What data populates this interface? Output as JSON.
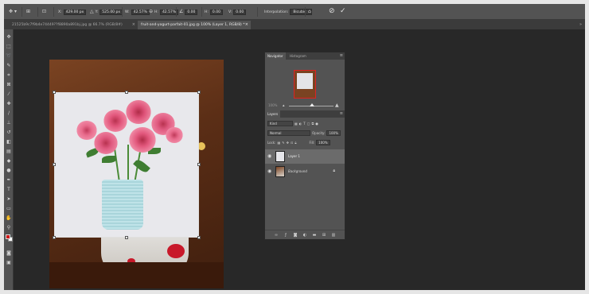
{
  "options_bar": {
    "x_label": "X:",
    "x_value": "429.00 px",
    "y_label": "Y:",
    "y_value": "525.00 px",
    "w_label": "W:",
    "w_value": "42.57%",
    "h_label": "H:",
    "h_value": "42.57%",
    "angle_value": "0.00",
    "hskew_label": "H:",
    "hskew_value": "0.00",
    "vskew_label": "V:",
    "vskew_value": "0.00",
    "interpolation_label": "Interpolation:",
    "interpolation_value": "Bicubic",
    "cancel_icon": "cancel-circle-icon",
    "commit_icon": "checkmark-icon"
  },
  "tabs": [
    {
      "label": "21525b9c7f9b4e74449??f8890a891bj.jpg @ 66.7% (RGB/8#)",
      "active": false
    },
    {
      "label": "fruit-and-yogurt-parfait-01.jpg @ 100% (Layer 1, RGB/8) *",
      "active": true
    }
  ],
  "navigator": {
    "tab_navigator": "Navigator",
    "tab_histogram": "Histogram",
    "zoom_text": "100%"
  },
  "layers": {
    "tab_label": "Layers",
    "kind_label": "Kind",
    "blend_mode": "Normal",
    "opacity_label": "Opacity:",
    "opacity_value": "100%",
    "lock_label": "Lock:",
    "fill_label": "Fill:",
    "fill_value": "100%",
    "items": [
      {
        "name": "Layer 1",
        "selected": true,
        "italic": false
      },
      {
        "name": "Background",
        "selected": false,
        "italic": true
      }
    ]
  },
  "colors": {
    "foreground": "#d11b1b",
    "background": "#ffffff"
  }
}
